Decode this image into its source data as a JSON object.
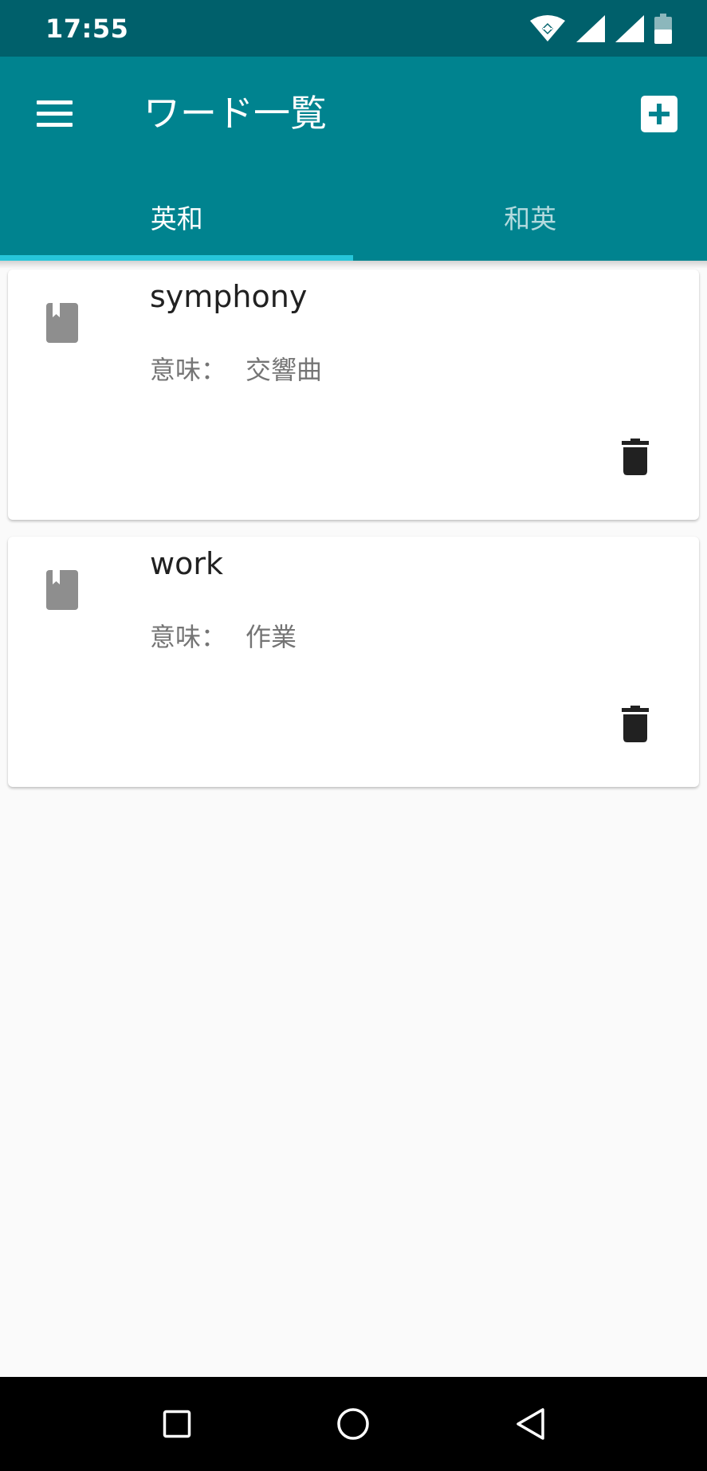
{
  "status_bar": {
    "time": "17:55",
    "icons": [
      "wifi-icon",
      "signal-icon",
      "signal-icon",
      "battery-icon"
    ]
  },
  "app_bar": {
    "title": "ワード一覧",
    "menu_icon": "menu-icon",
    "add_icon": "add-box-icon"
  },
  "tabs": [
    {
      "label": "英和",
      "selected": true
    },
    {
      "label": "和英",
      "selected": false
    }
  ],
  "words": [
    {
      "word": "symphony",
      "meaning_label": "意味：",
      "meaning": "交響曲",
      "icon": "book-icon",
      "action_icon": "delete-icon"
    },
    {
      "word": "work",
      "meaning_label": "意味：",
      "meaning": "作業",
      "icon": "book-icon",
      "action_icon": "delete-icon"
    }
  ],
  "colors": {
    "status_bar": "#00606b",
    "primary": "#00838f",
    "tab_indicator": "#26c6da",
    "background": "#fafafa",
    "icon_gray": "#8e8e8e"
  },
  "nav_bar": {
    "buttons": [
      "recents-button",
      "home-button",
      "back-button"
    ]
  }
}
